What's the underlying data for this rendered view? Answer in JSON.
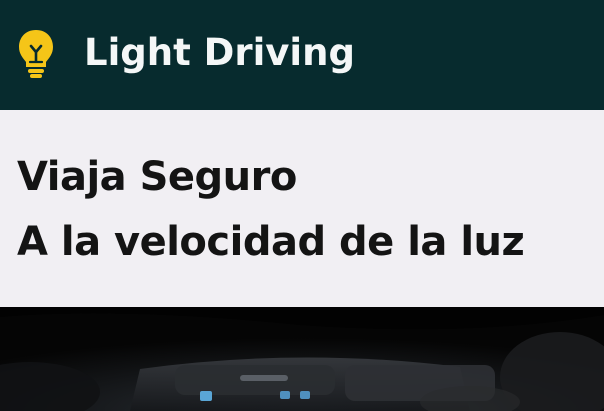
{
  "header": {
    "brand": "Light Driving",
    "logo_icon": "lightbulb-icon",
    "background_color": "#072b2e",
    "logo_color": "#f5c518"
  },
  "hero": {
    "line1": "Viaja Seguro",
    "line2": "A la velocidad de la luz"
  },
  "photo": {
    "subject": "car-interior-dashboard-image"
  }
}
